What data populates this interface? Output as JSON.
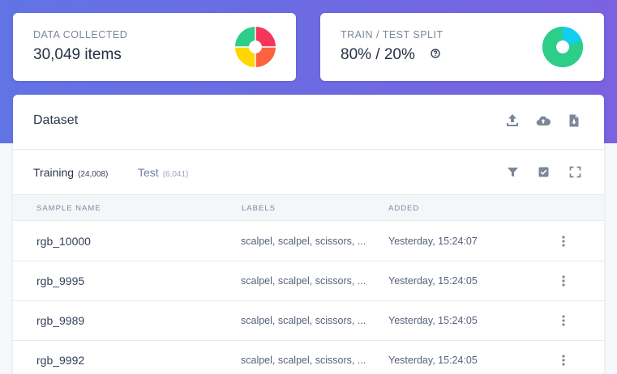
{
  "colors": {
    "hero_start": "#6273e4",
    "hero_end": "#7a62e0",
    "icon": "#7d8799",
    "donut_red": "#f5365c",
    "donut_orange": "#fb6340",
    "donut_yellow": "#ffd600",
    "donut_green": "#2dce89",
    "donut_cyan": "#11cdef"
  },
  "stats": {
    "collected": {
      "label": "DATA COLLECTED",
      "value": "30,049 items",
      "icon": "multi-color-donut"
    },
    "split": {
      "label": "TRAIN / TEST SPLIT",
      "value": "80% / 20%",
      "help_icon": "question-circle",
      "train_share": 0.8,
      "test_share": 0.2
    }
  },
  "panel": {
    "title": "Dataset",
    "header_icons": [
      "upload-icon",
      "cloud-upload-icon",
      "file-download-icon"
    ],
    "tabs": [
      {
        "label": "Training",
        "count": "(24,008)",
        "active": true
      },
      {
        "label": "Test",
        "count": "(6,041)",
        "active": false
      }
    ],
    "tab_icons": [
      "filter-icon",
      "check-square-icon",
      "expand-icon"
    ],
    "columns": [
      "SAMPLE NAME",
      "LABELS",
      "ADDED"
    ],
    "rows": [
      {
        "name": "rgb_10000",
        "labels": "scalpel, scalpel, scissors, ...",
        "added": "Yesterday, 15:24:07"
      },
      {
        "name": "rgb_9995",
        "labels": "scalpel, scalpel, scissors, ...",
        "added": "Yesterday, 15:24:05"
      },
      {
        "name": "rgb_9989",
        "labels": "scalpel, scalpel, scissors, ...",
        "added": "Yesterday, 15:24:05"
      },
      {
        "name": "rgb_9992",
        "labels": "scalpel, scalpel, scissors, ...",
        "added": "Yesterday, 15:24:05"
      }
    ]
  }
}
